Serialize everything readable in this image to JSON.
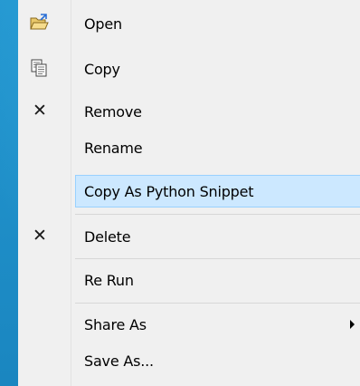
{
  "context_menu": {
    "items": [
      {
        "id": "open",
        "label": "Open",
        "icon": "open-folder-icon"
      },
      {
        "id": "copy",
        "label": "Copy",
        "icon": "copy-icon"
      },
      {
        "id": "remove",
        "label": "Remove",
        "icon": "x-icon"
      },
      {
        "id": "rename",
        "label": "Rename",
        "icon": null
      },
      {
        "id": "copy_python",
        "label": "Copy As Python Snippet",
        "icon": null,
        "highlighted": true
      },
      {
        "id": "delete",
        "label": "Delete",
        "icon": "x-icon"
      },
      {
        "id": "rerun",
        "label": "Re Run",
        "icon": null
      },
      {
        "id": "share_as",
        "label": "Share As",
        "icon": null,
        "has_submenu": true
      },
      {
        "id": "save_as",
        "label": "Save As...",
        "icon": null
      }
    ],
    "x_glyph": "✕"
  },
  "colors": {
    "desktop_background": "#1f8fc8",
    "menu_background": "#f0f0f0",
    "highlight_fill": "#cce8ff",
    "highlight_border": "#99d1ff",
    "separator": "#d7d7d7"
  }
}
